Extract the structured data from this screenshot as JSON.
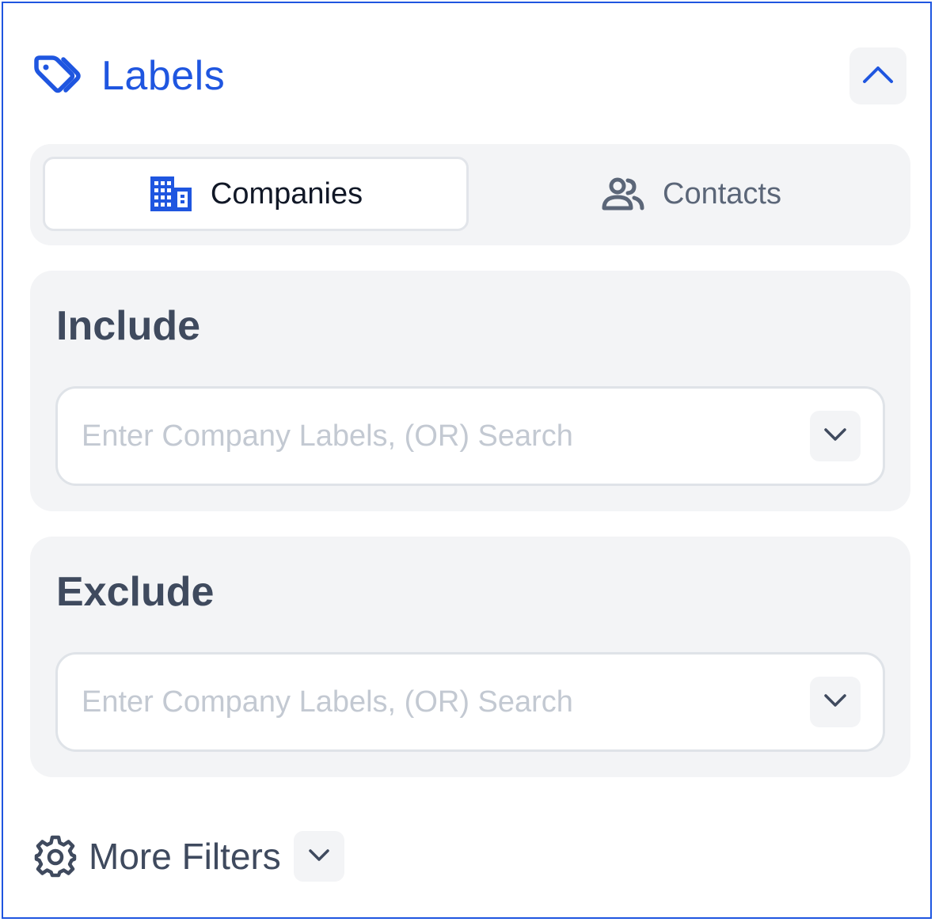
{
  "colors": {
    "accent": "#1f56e0",
    "panel_border": "#1f56e0",
    "section_bg": "#f3f4f6",
    "heading_text": "#3f4a5e",
    "placeholder_text": "#c3c9d2"
  },
  "header": {
    "icon": "tag-icon",
    "title": "Labels",
    "collapse_icon": "chevron-up-icon"
  },
  "tabs": [
    {
      "label": "Companies",
      "icon": "building-icon",
      "selected": true
    },
    {
      "label": "Contacts",
      "icon": "users-icon",
      "selected": false
    }
  ],
  "include": {
    "title": "Include",
    "placeholder": "Enter Company Labels, (OR) Search",
    "value": "",
    "dropdown_icon": "chevron-down-icon"
  },
  "exclude": {
    "title": "Exclude",
    "placeholder": "Enter Company Labels, (OR) Search",
    "value": "",
    "dropdown_icon": "chevron-down-icon"
  },
  "more_filters": {
    "icon": "gear-icon",
    "label": "More Filters",
    "toggle_icon": "chevron-down-icon"
  }
}
